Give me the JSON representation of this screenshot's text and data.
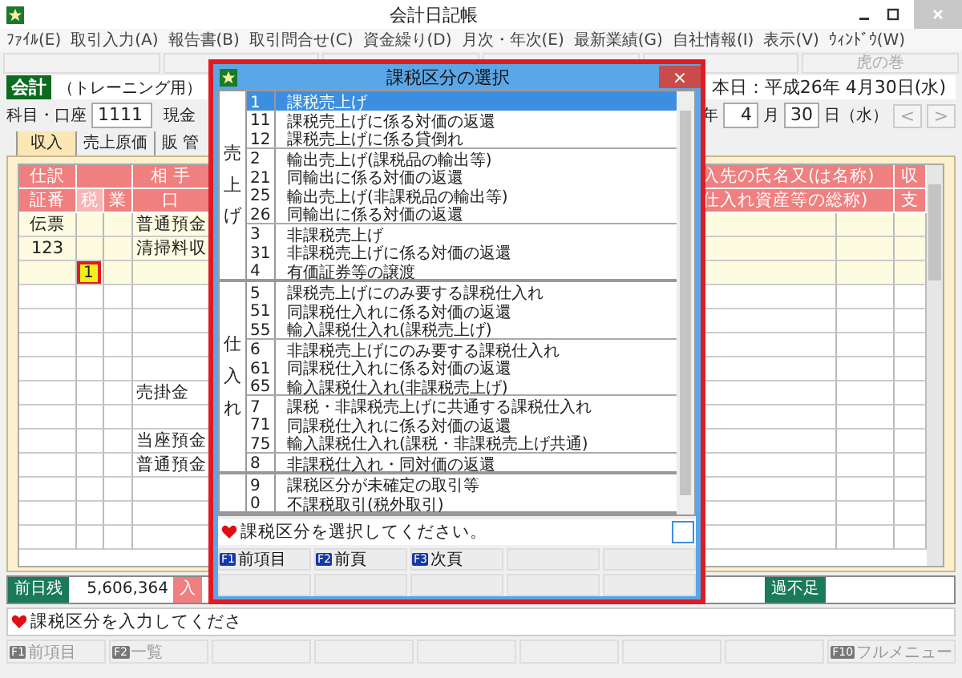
{
  "window": {
    "title": "会計日記帳"
  },
  "menu": [
    "ﾌｧｲﾙ(E)",
    "取引入力(A)",
    "報告書(B)",
    "取引問合せ(C)",
    "資金繰り(D)",
    "月次・年次(E)",
    "最新業績(G)",
    "自社情報(I)",
    "表示(V)",
    "ｳｨﾝﾄﾞｳ(W)"
  ],
  "toolbar": {
    "tip_button": {
      "label": "虎の巻",
      "disabled": true
    }
  },
  "header": {
    "badge": "会計",
    "mode": "（トレーニング用）",
    "today": "本日：平成26年 4月30日(水)"
  },
  "account": {
    "label": "科目・口座",
    "code": "1111",
    "name": "現金",
    "year_unit": "年",
    "month": "4",
    "month_unit": "月",
    "day": "30",
    "day_unit": "日（水）",
    "prev": "<",
    "next": ">"
  },
  "tabs": [
    {
      "label": "収入",
      "selected": true
    },
    {
      "label": "売上原価",
      "selected": false
    },
    {
      "label": "販 管",
      "selected": false
    }
  ],
  "table": {
    "header_left": [
      "仕訳",
      "証番",
      "税",
      "業",
      "相 手",
      "口"
    ],
    "header_right": [
      "入先の氏名又(は名称)",
      "仕入れ資産等の総称)"
    ],
    "header_sign": [
      "収",
      "支"
    ],
    "rows": [
      {
        "slip": "伝票",
        "account": "普通預金"
      },
      {
        "slip": "123",
        "account": "清掃料収"
      },
      {
        "tax_input": "1"
      },
      {},
      {},
      {},
      {},
      {
        "account": "売掛金"
      },
      {},
      {
        "account": "当座預金"
      },
      {
        "account": "普通預金"
      },
      {},
      {},
      {}
    ]
  },
  "summary": {
    "prev_label": "前日残",
    "prev_value": "5,606,364",
    "in_label": "入",
    "shortage_label": "過不足"
  },
  "message": "課税区分を入力してくださ",
  "fkeys": [
    {
      "key": "F1",
      "label": "前項目"
    },
    {
      "key": "F2",
      "label": "一覧"
    },
    {
      "key": "F10",
      "label": "フルメニュー"
    }
  ],
  "dialog": {
    "title": "課税区分の選択",
    "close": "×",
    "groups": [
      {
        "label": "売上げ",
        "subgroups": [
          [
            {
              "code": "1",
              "name": "課税売上げ",
              "selected": true
            },
            {
              "code": "11",
              "name": "課税売上げに係る対価の返還",
              "selected": false
            },
            {
              "code": "12",
              "name": "課税売上げに係る貸倒れ",
              "selected": false
            }
          ],
          [
            {
              "code": "2",
              "name": "輸出売上げ(課税品の輸出等)",
              "selected": false
            },
            {
              "code": "21",
              "name": "同輸出に係る対価の返還",
              "selected": false
            },
            {
              "code": "25",
              "name": "輸出売上げ(非課税品の輸出等)",
              "selected": false
            },
            {
              "code": "26",
              "name": "同輸出に係る対価の返還",
              "selected": false
            }
          ],
          [
            {
              "code": "3",
              "name": "非課税売上げ",
              "selected": false
            },
            {
              "code": "31",
              "name": "非課税売上げに係る対価の返還",
              "selected": false
            },
            {
              "code": "4",
              "name": "有価証券等の譲渡",
              "selected": false
            }
          ]
        ]
      },
      {
        "label": "仕入れ",
        "subgroups": [
          [
            {
              "code": "5",
              "name": "課税売上げにのみ要する課税仕入れ",
              "selected": false
            },
            {
              "code": "51",
              "name": "同課税仕入れに係る対価の返還",
              "selected": false
            },
            {
              "code": "55",
              "name": "輸入課税仕入れ(課税売上げ)",
              "selected": false
            }
          ],
          [
            {
              "code": "6",
              "name": "非課税売上げにのみ要する課税仕入れ",
              "selected": false
            },
            {
              "code": "61",
              "name": "同課税仕入れに係る対価の返還",
              "selected": false
            },
            {
              "code": "65",
              "name": "輸入課税仕入れ(非課税売上げ)",
              "selected": false
            }
          ],
          [
            {
              "code": "7",
              "name": "課税・非課税売上げに共通する課税仕入れ",
              "selected": false
            },
            {
              "code": "71",
              "name": "同課税仕入れに係る対価の返還",
              "selected": false
            },
            {
              "code": "75",
              "name": "輸入課税仕入れ(課税・非課税売上げ共通)",
              "selected": false
            }
          ],
          [
            {
              "code": "8",
              "name": "非課税仕入れ・同対価の返還",
              "selected": false
            }
          ]
        ]
      },
      {
        "subgroups": [
          [
            {
              "code": "9",
              "name": "課税区分が未確定の取引等",
              "selected": false
            },
            {
              "code": "0",
              "name": "不課税取引(税外取引)",
              "selected": false
            }
          ]
        ]
      }
    ],
    "message": "課税区分を選択してください。",
    "fkeys": [
      {
        "key": "F1",
        "label": "前項目"
      },
      {
        "key": "F2",
        "label": "前頁"
      },
      {
        "key": "F3",
        "label": "次頁"
      }
    ]
  }
}
